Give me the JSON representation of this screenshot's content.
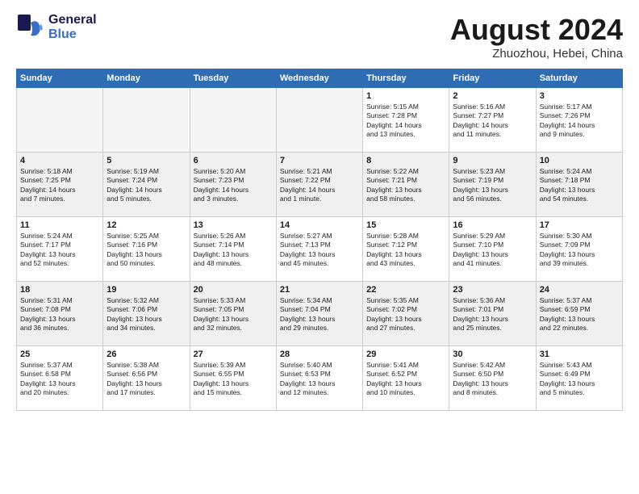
{
  "logo": {
    "line1": "General",
    "line2": "Blue"
  },
  "title": "August 2024",
  "location": "Zhuozhou, Hebei, China",
  "headers": [
    "Sunday",
    "Monday",
    "Tuesday",
    "Wednesday",
    "Thursday",
    "Friday",
    "Saturday"
  ],
  "weeks": [
    [
      {
        "day": "",
        "info": ""
      },
      {
        "day": "",
        "info": ""
      },
      {
        "day": "",
        "info": ""
      },
      {
        "day": "",
        "info": ""
      },
      {
        "day": "1",
        "info": "Sunrise: 5:15 AM\nSunset: 7:28 PM\nDaylight: 14 hours\nand 13 minutes."
      },
      {
        "day": "2",
        "info": "Sunrise: 5:16 AM\nSunset: 7:27 PM\nDaylight: 14 hours\nand 11 minutes."
      },
      {
        "day": "3",
        "info": "Sunrise: 5:17 AM\nSunset: 7:26 PM\nDaylight: 14 hours\nand 9 minutes."
      }
    ],
    [
      {
        "day": "4",
        "info": "Sunrise: 5:18 AM\nSunset: 7:25 PM\nDaylight: 14 hours\nand 7 minutes."
      },
      {
        "day": "5",
        "info": "Sunrise: 5:19 AM\nSunset: 7:24 PM\nDaylight: 14 hours\nand 5 minutes."
      },
      {
        "day": "6",
        "info": "Sunrise: 5:20 AM\nSunset: 7:23 PM\nDaylight: 14 hours\nand 3 minutes."
      },
      {
        "day": "7",
        "info": "Sunrise: 5:21 AM\nSunset: 7:22 PM\nDaylight: 14 hours\nand 1 minute."
      },
      {
        "day": "8",
        "info": "Sunrise: 5:22 AM\nSunset: 7:21 PM\nDaylight: 13 hours\nand 58 minutes."
      },
      {
        "day": "9",
        "info": "Sunrise: 5:23 AM\nSunset: 7:19 PM\nDaylight: 13 hours\nand 56 minutes."
      },
      {
        "day": "10",
        "info": "Sunrise: 5:24 AM\nSunset: 7:18 PM\nDaylight: 13 hours\nand 54 minutes."
      }
    ],
    [
      {
        "day": "11",
        "info": "Sunrise: 5:24 AM\nSunset: 7:17 PM\nDaylight: 13 hours\nand 52 minutes."
      },
      {
        "day": "12",
        "info": "Sunrise: 5:25 AM\nSunset: 7:16 PM\nDaylight: 13 hours\nand 50 minutes."
      },
      {
        "day": "13",
        "info": "Sunrise: 5:26 AM\nSunset: 7:14 PM\nDaylight: 13 hours\nand 48 minutes."
      },
      {
        "day": "14",
        "info": "Sunrise: 5:27 AM\nSunset: 7:13 PM\nDaylight: 13 hours\nand 45 minutes."
      },
      {
        "day": "15",
        "info": "Sunrise: 5:28 AM\nSunset: 7:12 PM\nDaylight: 13 hours\nand 43 minutes."
      },
      {
        "day": "16",
        "info": "Sunrise: 5:29 AM\nSunset: 7:10 PM\nDaylight: 13 hours\nand 41 minutes."
      },
      {
        "day": "17",
        "info": "Sunrise: 5:30 AM\nSunset: 7:09 PM\nDaylight: 13 hours\nand 39 minutes."
      }
    ],
    [
      {
        "day": "18",
        "info": "Sunrise: 5:31 AM\nSunset: 7:08 PM\nDaylight: 13 hours\nand 36 minutes."
      },
      {
        "day": "19",
        "info": "Sunrise: 5:32 AM\nSunset: 7:06 PM\nDaylight: 13 hours\nand 34 minutes."
      },
      {
        "day": "20",
        "info": "Sunrise: 5:33 AM\nSunset: 7:05 PM\nDaylight: 13 hours\nand 32 minutes."
      },
      {
        "day": "21",
        "info": "Sunrise: 5:34 AM\nSunset: 7:04 PM\nDaylight: 13 hours\nand 29 minutes."
      },
      {
        "day": "22",
        "info": "Sunrise: 5:35 AM\nSunset: 7:02 PM\nDaylight: 13 hours\nand 27 minutes."
      },
      {
        "day": "23",
        "info": "Sunrise: 5:36 AM\nSunset: 7:01 PM\nDaylight: 13 hours\nand 25 minutes."
      },
      {
        "day": "24",
        "info": "Sunrise: 5:37 AM\nSunset: 6:59 PM\nDaylight: 13 hours\nand 22 minutes."
      }
    ],
    [
      {
        "day": "25",
        "info": "Sunrise: 5:37 AM\nSunset: 6:58 PM\nDaylight: 13 hours\nand 20 minutes."
      },
      {
        "day": "26",
        "info": "Sunrise: 5:38 AM\nSunset: 6:56 PM\nDaylight: 13 hours\nand 17 minutes."
      },
      {
        "day": "27",
        "info": "Sunrise: 5:39 AM\nSunset: 6:55 PM\nDaylight: 13 hours\nand 15 minutes."
      },
      {
        "day": "28",
        "info": "Sunrise: 5:40 AM\nSunset: 6:53 PM\nDaylight: 13 hours\nand 12 minutes."
      },
      {
        "day": "29",
        "info": "Sunrise: 5:41 AM\nSunset: 6:52 PM\nDaylight: 13 hours\nand 10 minutes."
      },
      {
        "day": "30",
        "info": "Sunrise: 5:42 AM\nSunset: 6:50 PM\nDaylight: 13 hours\nand 8 minutes."
      },
      {
        "day": "31",
        "info": "Sunrise: 5:43 AM\nSunset: 6:49 PM\nDaylight: 13 hours\nand 5 minutes."
      }
    ]
  ]
}
